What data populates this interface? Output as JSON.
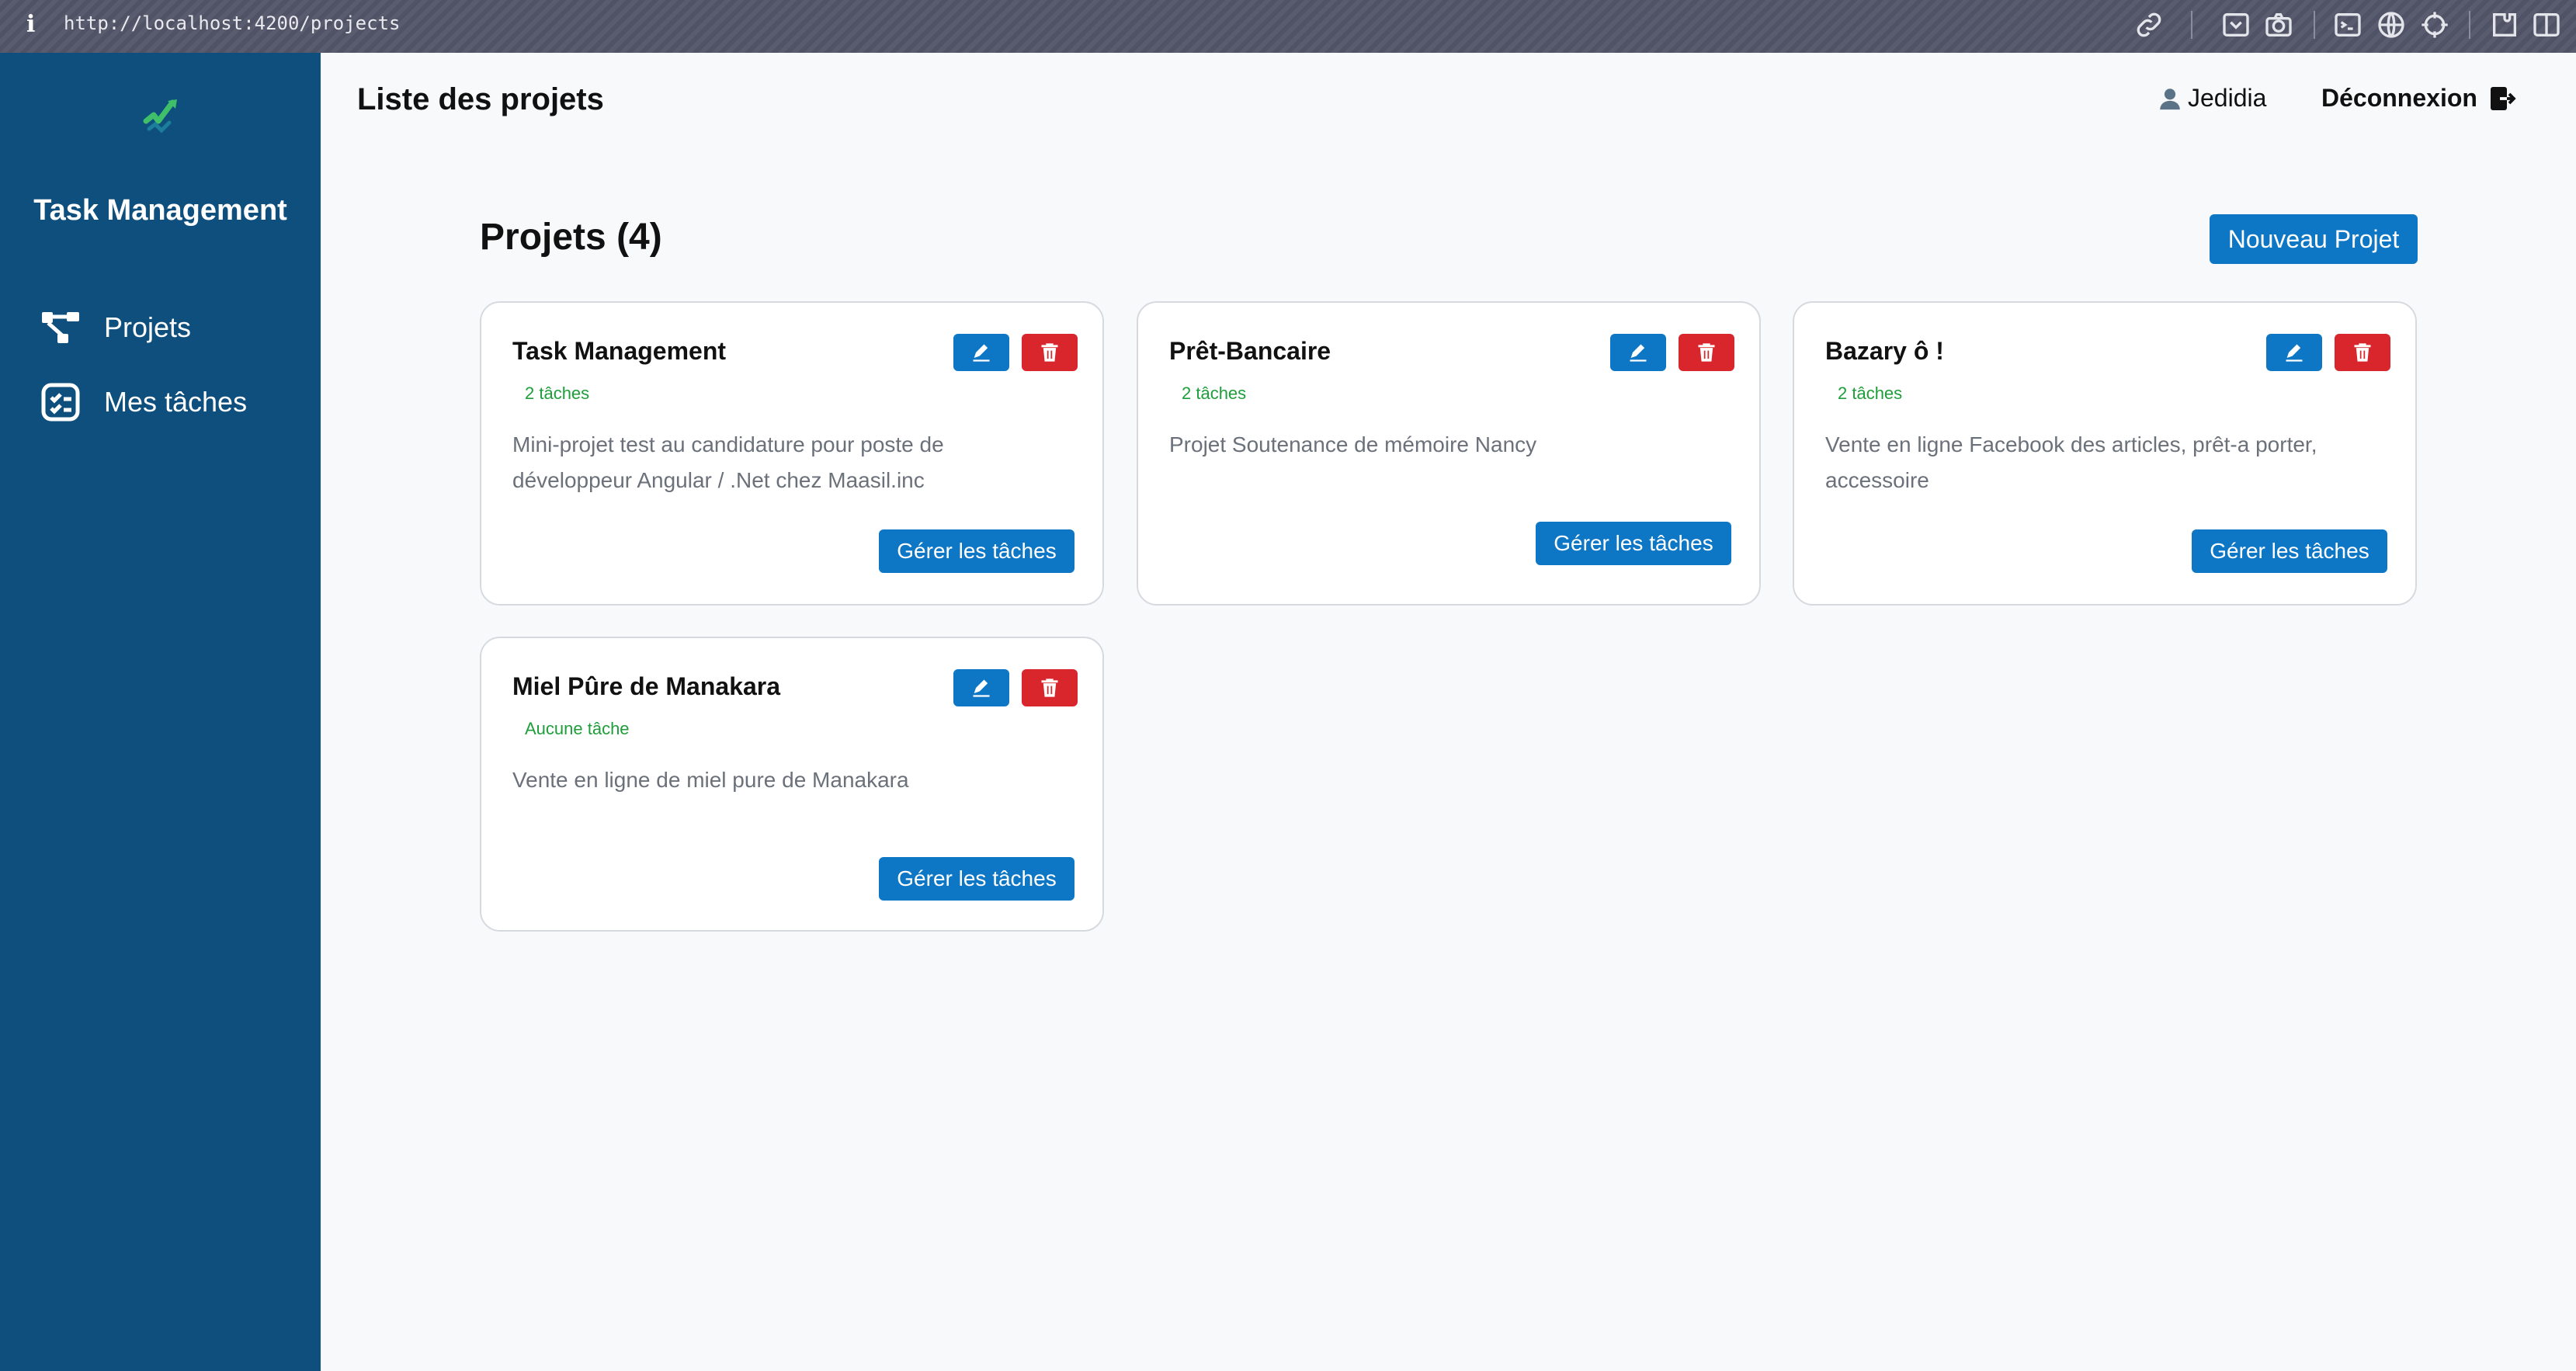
{
  "browser": {
    "url": "http://localhost:4200/projects"
  },
  "sidebar": {
    "title": "Task Management",
    "items": [
      {
        "label": "Projets",
        "icon": "hierarchy-icon"
      },
      {
        "label": "Mes tâches",
        "icon": "checklist-icon"
      }
    ]
  },
  "header": {
    "title": "Liste des projets",
    "user": "Jedidia",
    "logout": "Déconnexion"
  },
  "main": {
    "section_title": "Projets (4)",
    "new_project_label": "Nouveau Projet",
    "projects": [
      {
        "title": "Task Management",
        "task_count": "2 tâches",
        "description": "Mini-projet test au candidature pour poste de développeur Angular / .Net chez Maasil.inc",
        "manage_label": "Gérer les tâches"
      },
      {
        "title": "Prêt-Bancaire",
        "task_count": "2 tâches",
        "description": "Projet Soutenance de mémoire Nancy",
        "manage_label": "Gérer les tâches"
      },
      {
        "title": "Bazary ô !",
        "task_count": "2 tâches",
        "description": "Vente en ligne Facebook des articles, prêt-a porter, accessoire",
        "manage_label": "Gérer les tâches"
      },
      {
        "title": "Miel Pûre de Manakara",
        "task_count": "Aucune tâche",
        "description": "Vente en ligne de miel pure de Manakara",
        "manage_label": "Gérer les tâches"
      }
    ]
  },
  "colors": {
    "sidebar": "#0e4f7d",
    "primary": "#0d76c5",
    "danger": "#d8262c",
    "success": "#1e9e3a"
  }
}
